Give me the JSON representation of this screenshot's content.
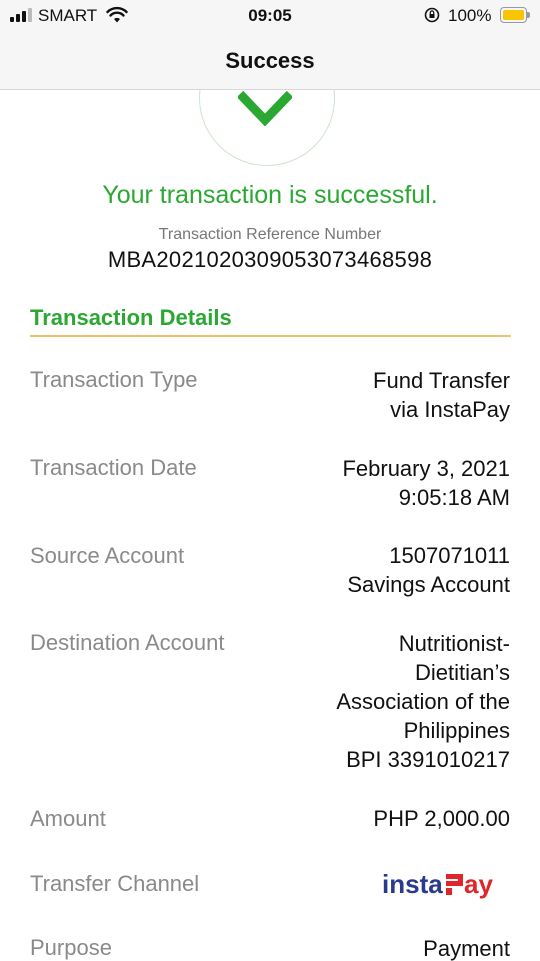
{
  "status_bar": {
    "carrier": "SMART",
    "time": "09:05",
    "battery": "100%"
  },
  "nav": {
    "title": "Success"
  },
  "result": {
    "message": "Your transaction is successful.",
    "reference_label": "Transaction Reference Number",
    "reference_number": "MBA20210203090530734 68598"
  },
  "details": {
    "section_title": "Transaction Details",
    "rows": [
      {
        "label": "Transaction Type",
        "value_lines": [
          "Fund Transfer",
          "via InstaPay"
        ]
      },
      {
        "label": "Transaction Date",
        "value_lines": [
          "February 3, 2021",
          "9:05:18 AM"
        ]
      },
      {
        "label": "Source Account",
        "value_lines": [
          "1507071011",
          "Savings Account"
        ]
      },
      {
        "label": "Destination Account",
        "value_lines": [
          "Nutritionist-",
          "Dietitian’s",
          "Association of the",
          "Philippines",
          "BPI 3391010217"
        ]
      },
      {
        "label": "Amount",
        "value_lines": [
          "PHP 2,000.00"
        ]
      },
      {
        "label": "Transfer Channel",
        "logo": "instapay-logo"
      },
      {
        "label": "Purpose",
        "value_lines": [
          "Payment"
        ]
      }
    ]
  },
  "colors": {
    "success_green": "#2aa832",
    "label_gray": "#8a8a8a",
    "rule_gold": "#e8c36a",
    "instapay_blue": "#2a3a8c",
    "instapay_red": "#e0262b"
  }
}
